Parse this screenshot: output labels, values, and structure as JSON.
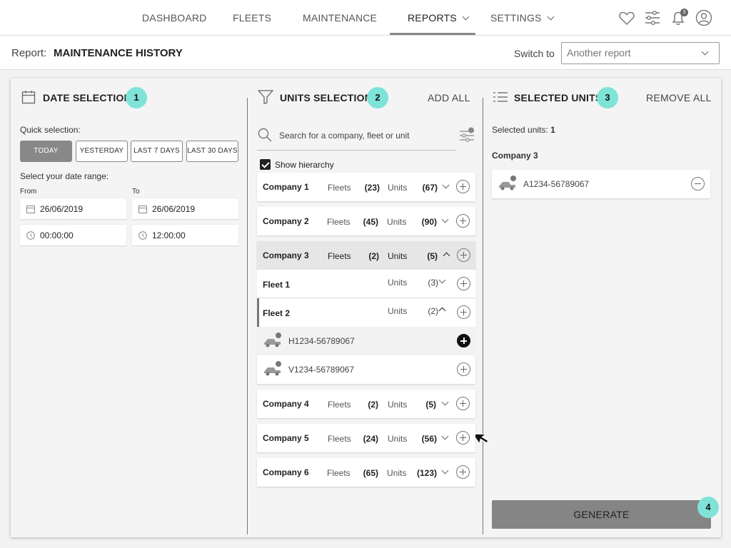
{
  "nav": {
    "items": [
      {
        "label": "DASHBOARD"
      },
      {
        "label": "FLEETS"
      },
      {
        "label": "MAINTENANCE"
      },
      {
        "label": "REPORTS"
      },
      {
        "label": "SETTINGS"
      }
    ],
    "active": "REPORTS",
    "icons": [
      "heart-icon",
      "sliders-icon",
      "bell-icon",
      "user-icon"
    ],
    "notification_count": "3"
  },
  "report_bar": {
    "label": "Report:",
    "name": "MAINTENANCE HISTORY",
    "switch_label": "Switch to",
    "switch_placeholder": "Another report"
  },
  "date_selection": {
    "title": "DATE SELECTION",
    "step": "1",
    "quick_label": "Quick selection:",
    "quick_buttons": [
      "TODAY",
      "YESTERDAY",
      "LAST 7 DAYS",
      "LAST 30 DAYS"
    ],
    "selected_quick": "TODAY",
    "range_label": "Select your date range:",
    "from_label": "From",
    "to_label": "To",
    "from_date": "26/06/2019",
    "to_date": "26/06/2019",
    "from_time": "00:00:00",
    "to_time": "12:00:00"
  },
  "units_selection": {
    "title": "UNITS SELECTION",
    "step": "2",
    "add_all": "ADD ALL",
    "search_placeholder": "Search for a company, fleet or unit",
    "show_hierarchy": "Show hierarchy",
    "fleets_label": "Fleets",
    "units_label": "Units",
    "companies": [
      {
        "name": "Company 1",
        "fleets": "(23)",
        "units": "(67)"
      },
      {
        "name": "Company 2",
        "fleets": "(45)",
        "units": "(90)"
      },
      {
        "name": "Company 3",
        "fleets": "(2)",
        "units": "(5)"
      },
      {
        "name": "Company 4",
        "fleets": "(2)",
        "units": "(5)"
      },
      {
        "name": "Company 5",
        "fleets": "(24)",
        "units": "(56)"
      },
      {
        "name": "Company 6",
        "fleets": "(65)",
        "units": "(123)"
      }
    ],
    "fleets": [
      {
        "name": "Fleet 1",
        "units": "(3)"
      },
      {
        "name": "Fleet 2",
        "units": "(2)"
      }
    ],
    "units": [
      {
        "name": "H1234-56789067"
      },
      {
        "name": "V1234-56789067"
      }
    ]
  },
  "selected_units": {
    "title": "SELECTED UNITS",
    "step": "3",
    "remove_all": "REMOVE ALL",
    "count_label": "Selected units:",
    "count": "1",
    "company": "Company 3",
    "items": [
      {
        "name": "A1234-56789067"
      }
    ]
  },
  "generate": {
    "label": "GENERATE",
    "step": "4"
  },
  "colors": {
    "accent_badge": "#7fe3d8",
    "button_gray": "#858585"
  }
}
